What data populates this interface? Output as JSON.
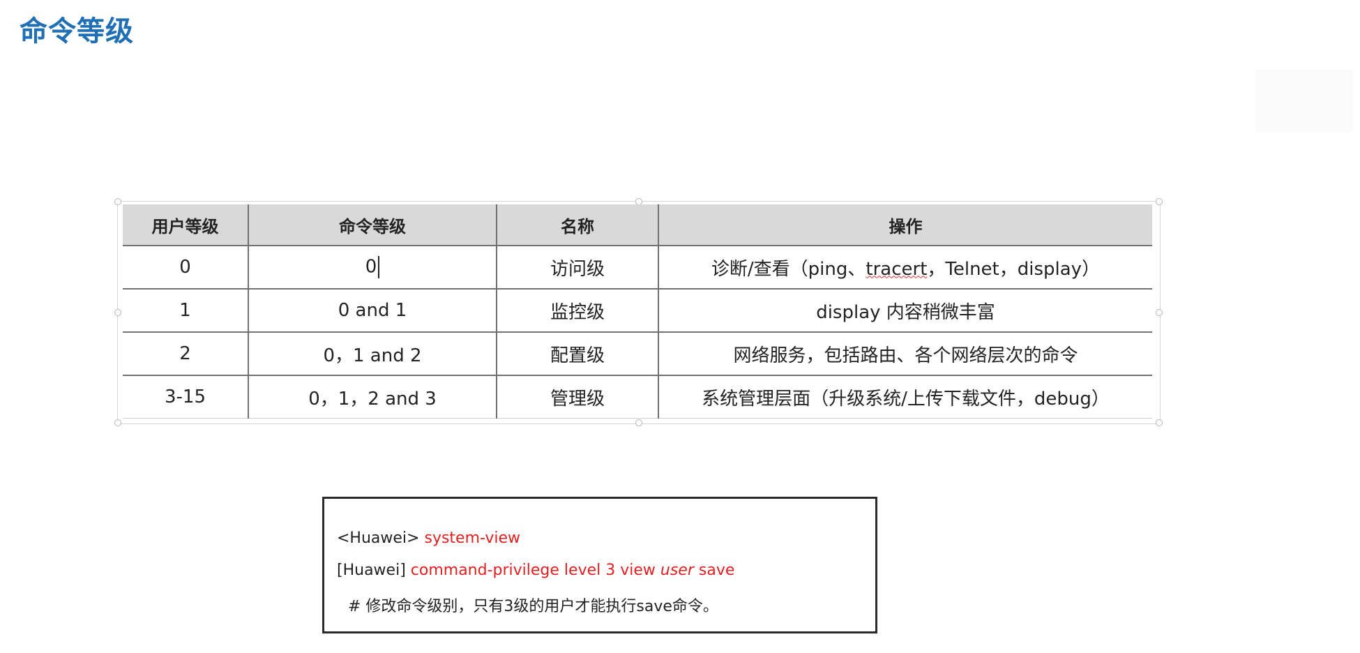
{
  "title": "命令等级",
  "table": {
    "headers": [
      "用户等级",
      "命令等级",
      "名称",
      "操作"
    ],
    "rows": [
      {
        "user_level": "0",
        "cmd_level": "0",
        "name": "访问级",
        "op_pre": "诊断/查看（ping、",
        "op_spell": "tracert",
        "op_post": "，Telnet，display）"
      },
      {
        "user_level": "1",
        "cmd_level": "0 and 1",
        "name": "监控级",
        "op": "display 内容稍微丰富"
      },
      {
        "user_level": "2",
        "cmd_level": "0，1 and 2",
        "name": "配置级",
        "op": "网络服务，包括路由、各个网络层次的命令"
      },
      {
        "user_level": "3-15",
        "cmd_level": "0，1，2 and 3",
        "name": "管理级",
        "op": "系统管理层面（升级系统/上传下载文件，debug）"
      }
    ]
  },
  "command_box": {
    "line1_prompt": "<Huawei>",
    "line1_cmd": "system-view",
    "line2_prompt": "[Huawei]",
    "line2_cmd": "command-privilege level 3 view",
    "line2_arg": "user",
    "line2_tail": "save",
    "comment": "# 修改命令级别，只有3级的用户才能执行save命令。"
  },
  "colors": {
    "title": "#1f6fb5",
    "header_bg": "#d9d9d9",
    "command_red": "#e02020"
  }
}
